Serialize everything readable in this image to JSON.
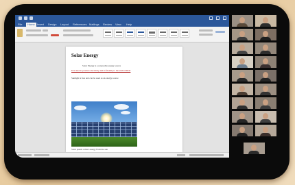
{
  "document": {
    "title": "Solar Energy",
    "line1": "Solar Energy is a renewable energy source",
    "line2": "It is used to produce electricity and is friendly to the environment",
    "line3": "Sunlight is free and can be used as an energy source",
    "caption": "Solar panels collect energy from the sun"
  },
  "ribbon": {
    "tabs": [
      "File",
      "Home",
      "Insert",
      "Design",
      "Layout",
      "References",
      "Mailings",
      "Review",
      "View",
      "Help"
    ],
    "active_tab": "Home"
  },
  "colors": {
    "word_blue": "#2b579a",
    "frame": "#0b0b0b",
    "title_link_red": "#a11111"
  },
  "participants": {
    "visible_tiles": 19
  }
}
